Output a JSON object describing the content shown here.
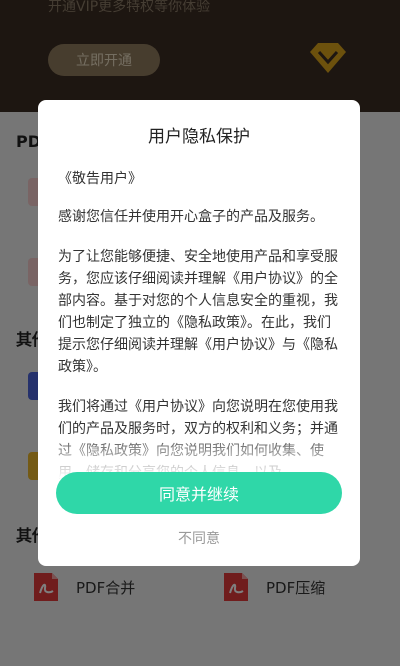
{
  "background": {
    "vip": {
      "subtitle": "开通VIP更多特权等你体验",
      "open_button": "立即开通"
    },
    "sections": [
      {
        "title": "PDF"
      },
      {
        "title": "其他"
      },
      {
        "title": "其他"
      }
    ],
    "tools": [
      {
        "label": "PDF合并",
        "icon": "pdf-icon"
      },
      {
        "label": "PDF压缩",
        "icon": "pdf-icon"
      }
    ]
  },
  "dialog": {
    "title": "用户隐私保护",
    "greeting": "《敬告用户》",
    "paragraphs": [
      "感谢您信任并使用开心盒子的产品及服务。",
      "为了让您能够便捷、安全地使用产品和享受服务，您应该仔细阅读并理解《用户协议》的全部内容。基于对您的个人信息安全的重视，我们也制定了独立的《隐私政策》。在此，我们提示您仔细阅读并理解《用户协议》与《隐私政策》。",
      "我们将通过《用户协议》向您说明在您使用我们的产品及服务时，双方的权利和义务；并通过《隐私政策》向您说明我们如何收集、使用、储存和分享您的个人信息，以及"
    ],
    "agree_button": "同意并继续",
    "disagree_link": "不同意"
  },
  "colors": {
    "accent": "#2fd7a8",
    "vip_gold": "#d8a21a",
    "pdf_red": "#e03b3b"
  }
}
